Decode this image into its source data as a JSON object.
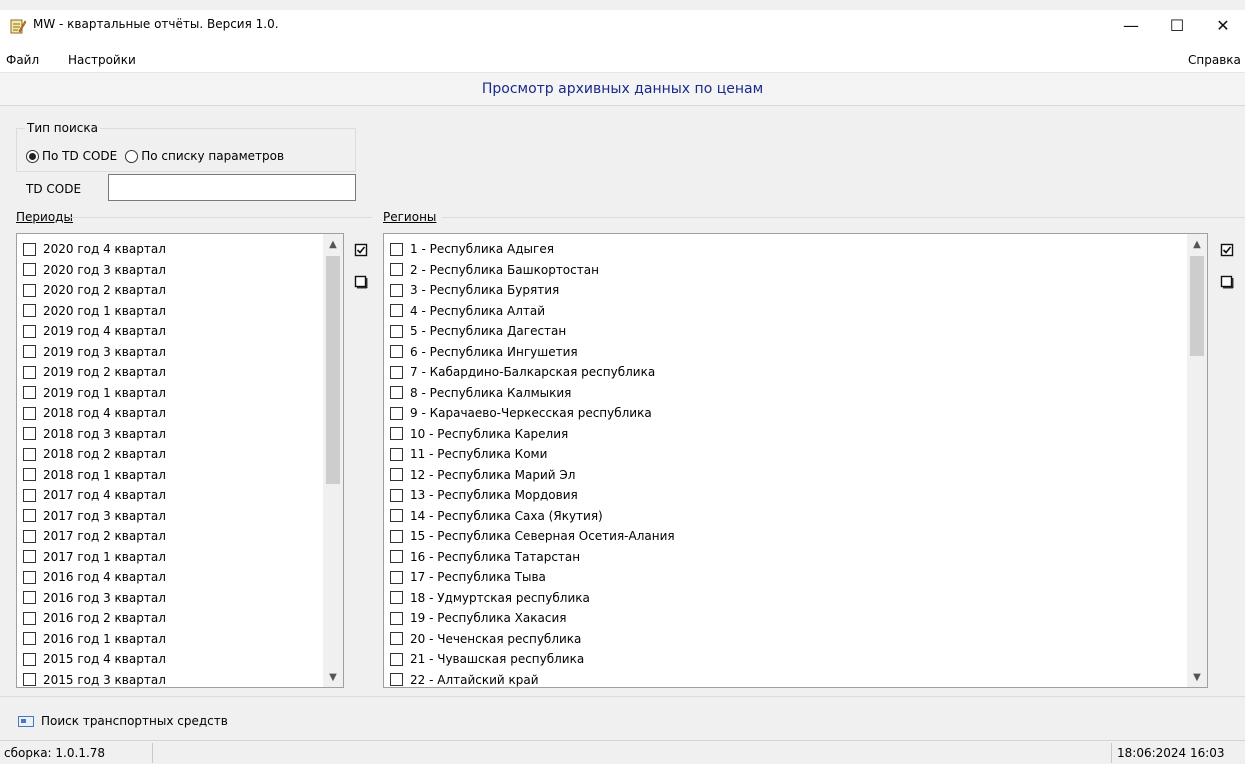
{
  "window": {
    "title": "MW - квартальные отчёты. Версия 1.0.",
    "minimize": "—",
    "maximize": "☐",
    "close": "✕"
  },
  "menu": {
    "file": "Файл",
    "settings": "Настройки",
    "help": "Справка"
  },
  "header": {
    "title": "Просмотр архивных данных по ценам"
  },
  "search_type": {
    "legend": "Тип поиска",
    "option_td_code": "По TD CODE",
    "option_params": "По списку параметров",
    "selected": "По TD CODE"
  },
  "td_code": {
    "label": "TD CODE",
    "value": ""
  },
  "periods": {
    "label": "Периоды",
    "items": [
      "2020 год 4 квартал",
      "2020 год 3 квартал",
      "2020 год 2 квартал",
      "2020 год 1 квартал",
      "2019 год 4 квартал",
      "2019 год 3 квартал",
      "2019 год 2 квартал",
      "2019 год 1 квартал",
      "2018 год 4 квартал",
      "2018 год 3 квартал",
      "2018 год 2 квартал",
      "2018 год 1 квартал",
      "2017 год 4 квартал",
      "2017 год 3 квартал",
      "2017 год 2 квартал",
      "2017 год 1 квартал",
      "2016 год 4 квартал",
      "2016 год 3 квартал",
      "2016 год 2 квартал",
      "2016 год 1 квартал",
      "2015 год 4 квартал",
      "2015 год 3 квартал"
    ]
  },
  "regions": {
    "label": "Регионы",
    "items": [
      "1 - Республика Адыгея",
      "2 - Республика Башкортостан",
      "3 - Республика Бурятия",
      "4 - Республика Алтай",
      "5 - Республика Дагестан",
      "6 - Республика Ингушетия",
      "7 - Кабардино-Балкарская республика",
      "8 - Республика Калмыкия",
      "9 - Карачаево-Черкесская республика",
      "10 - Республика Карелия",
      "11 - Республика Коми",
      "12 - Республика Марий Эл",
      "13 - Республика Мордовия",
      "14 - Республика Саха (Якутия)",
      "15 - Республика Северная Осетия-Алания",
      "16 - Республика Татарстан",
      "17 - Республика Тыва",
      "18 - Удмуртская республика",
      "19 - Республика Хакасия",
      "20 - Чеченская республика",
      "21 - Чувашская республика",
      "22 - Алтайский край"
    ]
  },
  "bottom": {
    "vehicle_search": "Поиск транспортных средств"
  },
  "status": {
    "build": "сборка: 1.0.1.78",
    "datetime": "18:06:2024 16:03"
  },
  "colors": {
    "header_title": "#1a2a8a",
    "window_bg": "#f0f0f0"
  }
}
